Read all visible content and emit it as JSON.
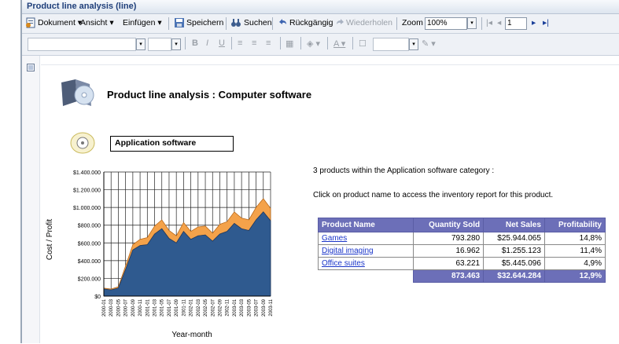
{
  "window": {
    "title": "Product line analysis (line)"
  },
  "toolbar": {
    "document_label": "Dokument",
    "view_label": "Ansicht",
    "insert_label": "Einfügen",
    "save_label": "Speichern",
    "search_label": "Suchen",
    "undo_label": "Rückgängig",
    "redo_label": "Wiederholen",
    "zoom_label": "Zoom",
    "zoom_value": "100%",
    "page_value": "1"
  },
  "report": {
    "title": "Product line analysis : Computer software",
    "subcategory": "Application software",
    "summary_text": "3 products within the Application software category :",
    "hint_text": "Click on product name to access the inventory report for this product.",
    "table": {
      "headers": [
        "Product Name",
        "Quantity Sold",
        "Net Sales",
        "Profitability"
      ],
      "rows": [
        [
          "Games",
          "793.280",
          "$25.944.065",
          "14,8%"
        ],
        [
          "Digital imaging",
          "16.962",
          "$1.255.123",
          "11,4%"
        ],
        [
          "Office suites",
          "63.221",
          "$5.445.096",
          "4,9%"
        ]
      ],
      "totals": [
        "873.463",
        "$32.644.284",
        "12,9%"
      ]
    }
  },
  "chart_data": {
    "type": "area",
    "xlabel": "Year-month",
    "ylabel": "Cost / Profit",
    "ylim": [
      0,
      1400000
    ],
    "y_ticks": [
      "$0",
      "$200.000",
      "$400.000",
      "$600.000",
      "$800.000",
      "$1.000.000",
      "$1.200.000",
      "$1.400.000"
    ],
    "x": [
      "2000-01",
      "2000-03",
      "2000-05",
      "2000-07",
      "2000-09",
      "2000-11",
      "2001-01",
      "2001-03",
      "2001-05",
      "2001-07",
      "2001-09",
      "2001-11",
      "2002-01",
      "2002-03",
      "2002-05",
      "2002-07",
      "2002-09",
      "2002-11",
      "2003-01",
      "2003-03",
      "2003-05",
      "2003-07",
      "2003-09",
      "2003-11"
    ],
    "x_tick_labels": [
      "2000-01",
      "2000-03",
      "2000-05",
      "2000-07",
      "2000-09",
      "2000-11",
      "2001-01",
      "2001-03",
      "2001-05",
      "2001-07",
      "2001-09",
      "2001-11",
      "2002-01",
      "2002-03",
      "2002-05",
      "2002-07",
      "2002-09",
      "2002-11",
      "2003-01",
      "2003-03",
      "2003-05",
      "2003-07",
      "2003-09",
      "2003-11"
    ],
    "series": [
      {
        "color": "#2f5a8f",
        "values": [
          80000,
          70000,
          90000,
          300000,
          520000,
          570000,
          580000,
          700000,
          760000,
          650000,
          600000,
          730000,
          640000,
          680000,
          690000,
          620000,
          700000,
          730000,
          820000,
          760000,
          740000,
          860000,
          950000,
          850000
        ]
      },
      {
        "color": "#f4a24a",
        "values": [
          10000,
          10000,
          15000,
          40000,
          60000,
          70000,
          80000,
          90000,
          100000,
          90000,
          80000,
          100000,
          90000,
          100000,
          100000,
          90000,
          110000,
          110000,
          130000,
          120000,
          120000,
          140000,
          150000,
          140000
        ]
      }
    ],
    "grid": true,
    "legend": "none"
  }
}
